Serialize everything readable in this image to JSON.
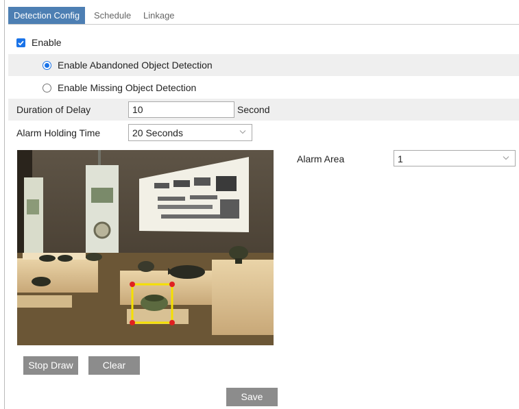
{
  "tabs": [
    {
      "label": "Detection Config",
      "active": true
    },
    {
      "label": "Schedule",
      "active": false
    },
    {
      "label": "Linkage",
      "active": false
    }
  ],
  "enable": {
    "label": "Enable",
    "checked": true
  },
  "modes": [
    {
      "label": "Enable Abandoned Object Detection",
      "selected": true
    },
    {
      "label": "Enable Missing Object Detection",
      "selected": false
    }
  ],
  "delay": {
    "label": "Duration of Delay",
    "value": "10",
    "unit": "Second"
  },
  "holding": {
    "label": "Alarm Holding Time",
    "value": "20 Seconds"
  },
  "alarm_area": {
    "label": "Alarm Area",
    "value": "1"
  },
  "buttons": {
    "stop_draw": "Stop Draw",
    "clear": "Clear",
    "save": "Save"
  },
  "colors": {
    "accent": "#1a73e8",
    "tab_active": "#4d7fb3",
    "button": "#8c8c8c",
    "roi_box": "#f5e000",
    "roi_handle": "#e02020"
  }
}
